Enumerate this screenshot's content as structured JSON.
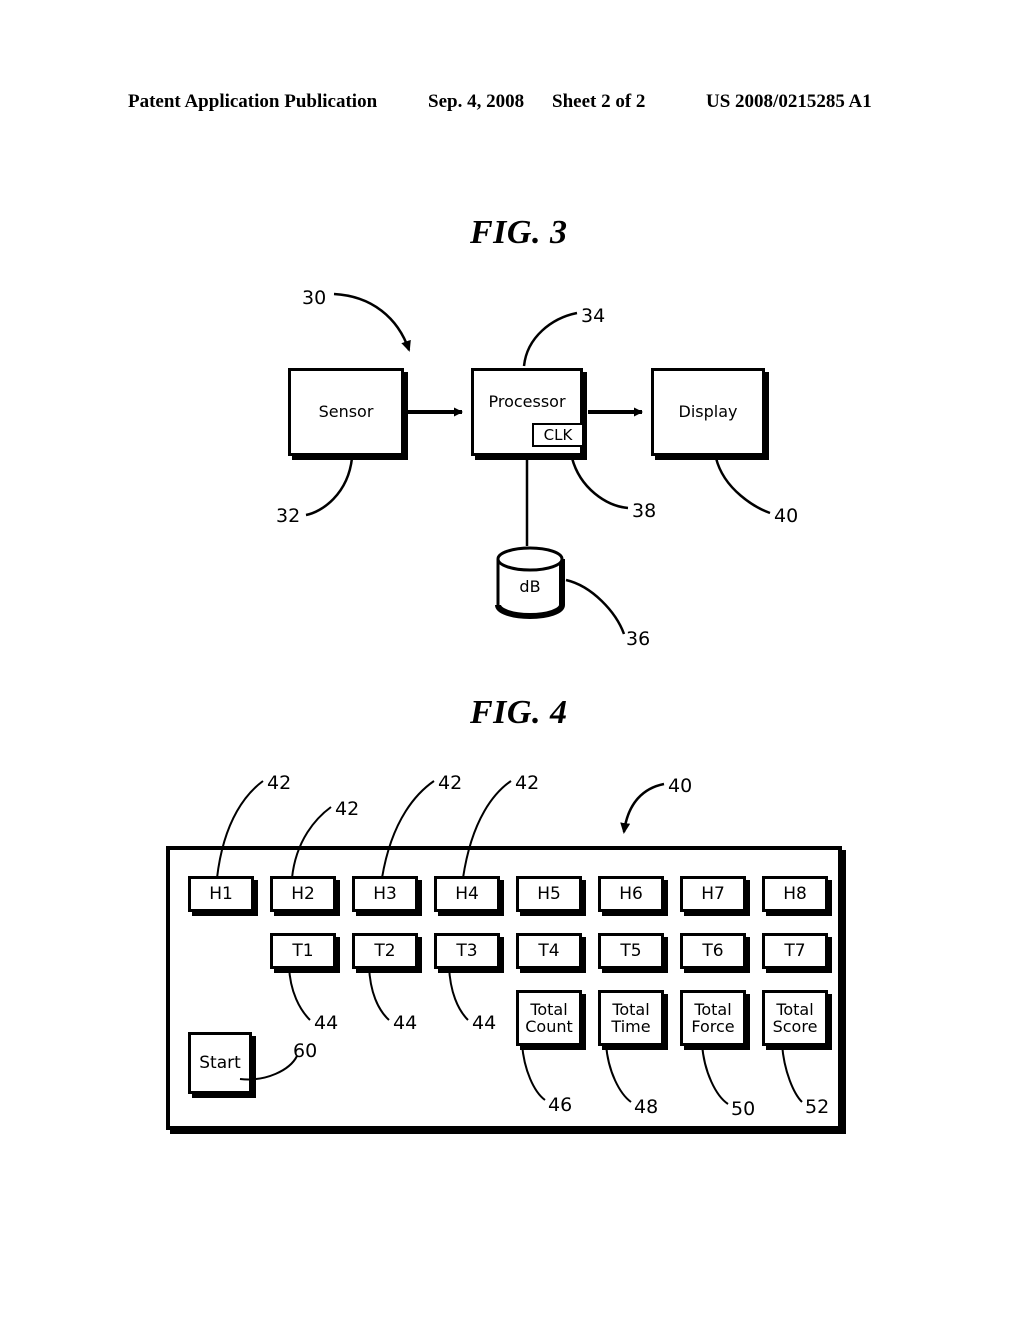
{
  "header": {
    "publication": "Patent Application Publication",
    "date": "Sep. 4, 2008",
    "sheet": "Sheet 2 of 2",
    "publication_number": "US 2008/0215285 A1"
  },
  "fig3": {
    "title": "FIG. 3",
    "blocks": [
      {
        "name": "sensor",
        "label": "Sensor",
        "ref": "32"
      },
      {
        "name": "processor",
        "label": "Processor",
        "ref": "34"
      },
      {
        "name": "display",
        "label": "Display",
        "ref": "40"
      }
    ],
    "clock": {
      "label": "CLK",
      "ref": "38"
    },
    "database": {
      "label": "dB",
      "ref": "36"
    },
    "system_ref": "30",
    "refs": {
      "system": "30",
      "sensor": "32",
      "processor": "34",
      "database": "36",
      "clock": "38",
      "display": "40"
    }
  },
  "fig4": {
    "title": "FIG. 4",
    "panel_ref": "40",
    "h_keys": [
      "H1",
      "H2",
      "H3",
      "H4",
      "H5",
      "H6",
      "H7",
      "H8"
    ],
    "t_keys": [
      "T1",
      "T2",
      "T3",
      "T4",
      "T5",
      "T6",
      "T7"
    ],
    "total_keys": [
      {
        "line1": "Total",
        "line2": "Count",
        "ref": "46"
      },
      {
        "line1": "Total",
        "line2": "Time",
        "ref": "48"
      },
      {
        "line1": "Total",
        "line2": "Force",
        "ref": "50"
      },
      {
        "line1": "Total",
        "line2": "Score",
        "ref": "52"
      }
    ],
    "start": {
      "label": "Start",
      "ref": "60"
    },
    "h_key_ref": "42",
    "t_key_ref": "44",
    "h_key_refs": [
      "42",
      "42",
      "42",
      "42"
    ],
    "t_key_refs": [
      "44",
      "44",
      "44"
    ]
  },
  "colors": {
    "ink": "#000000",
    "paper": "#ffffff"
  }
}
